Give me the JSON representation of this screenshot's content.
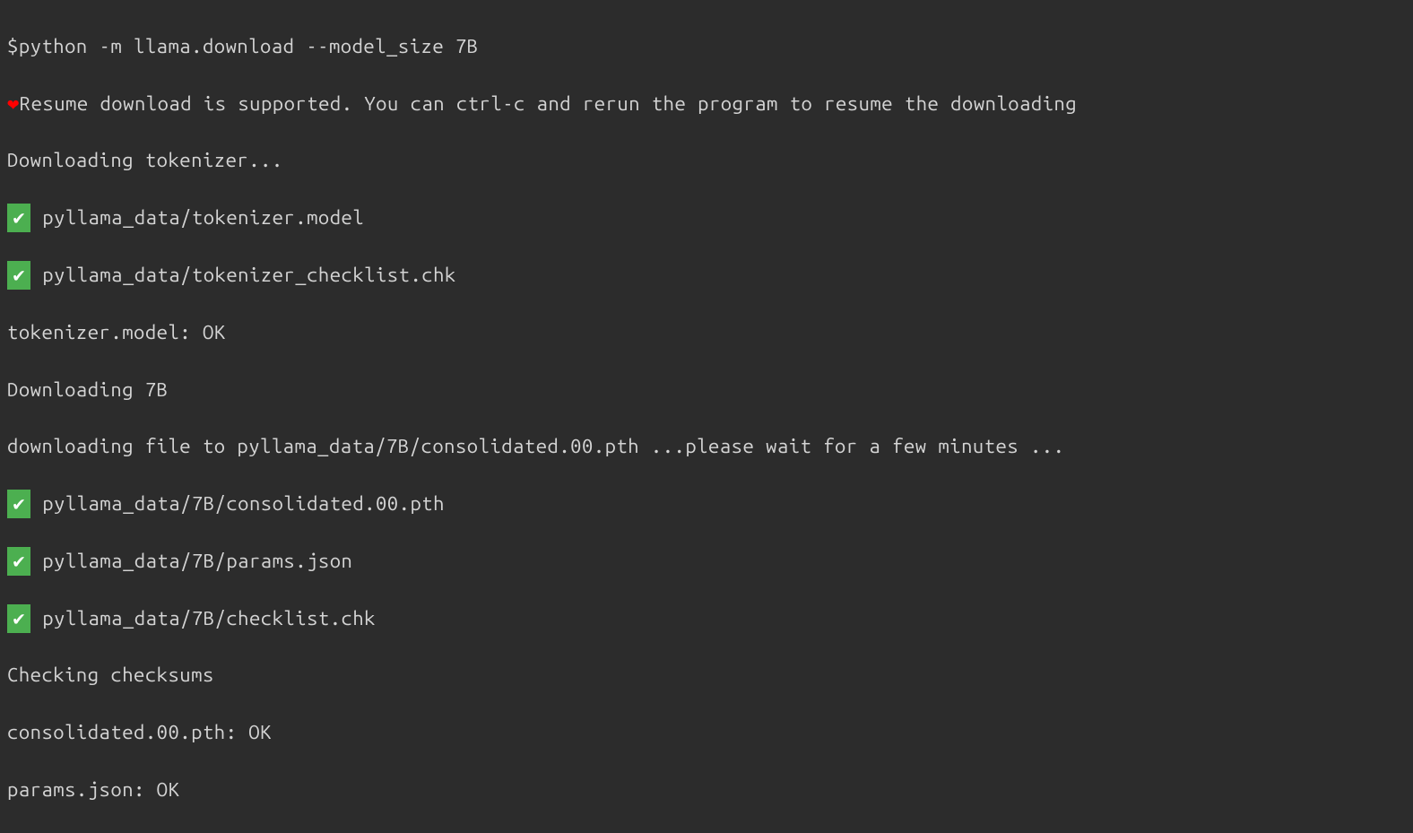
{
  "terminal": {
    "lines": [
      {
        "prefix_type": "none",
        "text": "$python -m llama.download --model_size 7B"
      },
      {
        "prefix_type": "heart",
        "text": "Resume download is supported. You can ctrl-c and rerun the program to resume the downloading"
      },
      {
        "prefix_type": "none",
        "text": "Downloading tokenizer..."
      },
      {
        "prefix_type": "check",
        "text": " pyllama_data/tokenizer.model"
      },
      {
        "prefix_type": "check",
        "text": " pyllama_data/tokenizer_checklist.chk"
      },
      {
        "prefix_type": "none",
        "text": "tokenizer.model: OK"
      },
      {
        "prefix_type": "none",
        "text": "Downloading 7B"
      },
      {
        "prefix_type": "none",
        "text": "downloading file to pyllama_data/7B/consolidated.00.pth ...please wait for a few minutes ..."
      },
      {
        "prefix_type": "check",
        "text": " pyllama_data/7B/consolidated.00.pth"
      },
      {
        "prefix_type": "check",
        "text": " pyllama_data/7B/params.json"
      },
      {
        "prefix_type": "check",
        "text": " pyllama_data/7B/checklist.chk"
      },
      {
        "prefix_type": "none",
        "text": "Checking checksums"
      },
      {
        "prefix_type": "none",
        "text": "consolidated.00.pth: OK"
      },
      {
        "prefix_type": "none",
        "text": "params.json: OK"
      }
    ]
  },
  "icons": {
    "heart": "❤",
    "check": "✔"
  }
}
